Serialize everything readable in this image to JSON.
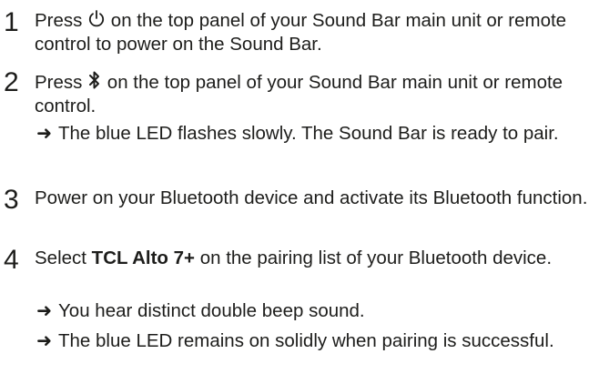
{
  "steps": [
    {
      "number": "1",
      "before_icon": "Press ",
      "icon": "power-icon",
      "after_icon": " on the top panel of your Sound Bar main unit or remote control to power on the Sound Bar."
    },
    {
      "number": "2",
      "before_icon": "Press ",
      "icon": "bluetooth-icon",
      "after_icon": " on the top panel of your Sound Bar main unit or remote control.",
      "results": [
        "The blue LED flashes slowly. The Sound Bar is ready to pair."
      ]
    },
    {
      "number": "3",
      "text": "Power on your Bluetooth device and activate its Bluetooth function."
    },
    {
      "number": "4",
      "before_bold": "Select ",
      "bold": "TCL Alto 7+",
      "after_bold": " on the pairing list of your Bluetooth device.",
      "results": [
        "You hear distinct double beep sound.",
        "The blue LED remains on solidly when pairing is successful."
      ]
    }
  ],
  "arrow_symbol": "➜"
}
